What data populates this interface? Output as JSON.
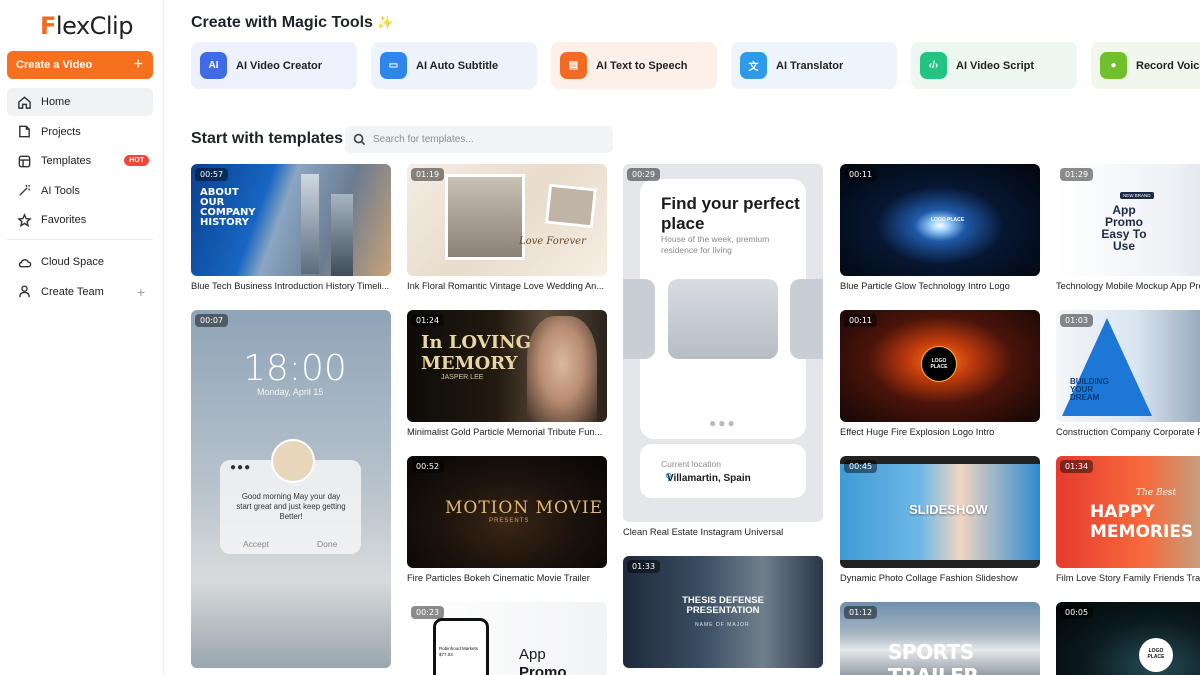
{
  "app": {
    "logo_initial": "F",
    "logo_rest": "lexClip"
  },
  "sidebar": {
    "create_label": "Create a Video",
    "items": [
      {
        "label": "Home",
        "icon": "home-icon"
      },
      {
        "label": "Projects",
        "icon": "projects-icon"
      },
      {
        "label": "Templates",
        "icon": "templates-icon",
        "badge": "HOT"
      },
      {
        "label": "AI Tools",
        "icon": "magic-wand-icon"
      },
      {
        "label": "Favorites",
        "icon": "star-icon"
      },
      {
        "label": "Cloud Space",
        "icon": "cloud-icon"
      },
      {
        "label": "Create Team",
        "icon": "user-icon"
      }
    ]
  },
  "main": {
    "magic_title": "Create with Magic Tools",
    "tools": [
      {
        "label": "AI Video Creator",
        "icon_text": "AI"
      },
      {
        "label": "AI Auto Subtitle",
        "icon_text": "▭"
      },
      {
        "label": "AI Text to Speech",
        "icon_text": "▤"
      },
      {
        "label": "AI Translator",
        "icon_text": "文"
      },
      {
        "label": "AI Video Script",
        "icon_text": "‹/›"
      },
      {
        "label": "Record Voice",
        "icon_text": "●"
      }
    ],
    "templates_title": "Start with templates",
    "search_placeholder": "Search for templates...",
    "cards": {
      "blue_tech": {
        "duration": "00:57",
        "title": "Blue Tech Business Introduction History Timeli...",
        "overlay": "ABOUT OUR COMPANY HISTORY"
      },
      "floral": {
        "duration": "01:19",
        "title": "Ink Floral Romantic Vintage Love Wedding An...",
        "overlay": "Love Forever"
      },
      "real_estate": {
        "duration": "00:29",
        "title": "Clean Real Estate Instagram Universal",
        "heading": "Find your perfect place",
        "sub": "House of the week, premium residence for living",
        "loc_label": "Current location",
        "loc_value": "Villamartin, Spain"
      },
      "glow": {
        "duration": "00:11",
        "title": "Blue Particle Glow Technology Intro Logo",
        "overlay": "LOGO PLACE"
      },
      "app_promo": {
        "duration": "01:29",
        "title": "Technology Mobile Mockup App Promo",
        "overlay": "App Promo Easy To Use",
        "badge": "NEW BRAND"
      },
      "clock": {
        "duration": "00:07",
        "time": "18:00",
        "date": "Monday, April 15",
        "msg": "Good morning May your day start great and just keep getting Better!",
        "accept": "Accept",
        "done": "Done"
      },
      "memory": {
        "duration": "01:24",
        "title": "Minimalist Gold Particle Memorial Tribute Fun...",
        "overlay": "In LOVING MEMORY",
        "name": "JASPER LEE"
      },
      "fire": {
        "duration": "00:11",
        "title": "Effect Huge Fire Explosion Logo Intro",
        "overlay": "LOGO PLACE"
      },
      "construction": {
        "duration": "01:03",
        "title": "Construction Company Corporate Promo",
        "overlay": "BUILDING YOUR DREAM"
      },
      "motion": {
        "duration": "00:52",
        "title": "Fire Particles Bokeh Cinematic Movie Trailer",
        "overlay": "MOTION MOVIE",
        "sub": "PRESENTS"
      },
      "slideshow": {
        "duration": "00:45",
        "title": "Dynamic Photo Collage Fashion Slideshow",
        "overlay": "SLIDESHOW"
      },
      "love_story": {
        "duration": "01:34",
        "title": "Film Love Story Family Friends Travel",
        "overlay_a": "The Best",
        "overlay_b": "HAPPY MEMORIES"
      },
      "app_robinhood": {
        "duration": "00:23",
        "overlay_a": "App",
        "overlay_b": "Promo",
        "phone_text": "Robinhood Markets $77.03"
      },
      "thesis": {
        "duration": "01:33",
        "overlay": "THESIS DEFENSE PRESENTATION",
        "sub": "NAME OF MAJOR"
      },
      "sports": {
        "duration": "01:12",
        "overlay": "SPORTS TRAILER"
      },
      "globe": {
        "duration": "00:05",
        "overlay": "LOGO PLACE"
      }
    }
  }
}
